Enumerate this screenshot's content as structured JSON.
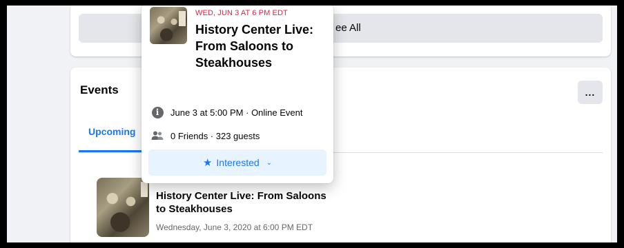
{
  "top_card": {
    "see_all_label": "ee All"
  },
  "events": {
    "title": "Events",
    "more_label": "...",
    "tabs": [
      {
        "label": "Upcoming"
      }
    ],
    "items": [
      {
        "title": "History Center Live: From Saloons to Steakhouses",
        "date": "Wednesday, June 3, 2020 at 6:00 PM EDT"
      }
    ]
  },
  "popup": {
    "date": "WED, JUN 3 AT 6 PM EDT",
    "title": "History Center Live: From Saloons to Steakhouses",
    "time_info": "June 3 at 5:00 PM · Online Event",
    "guests_info": "0 Friends · 323 guests",
    "interested_label": "Interested",
    "icons": {
      "info": "info-icon",
      "guests": "people-icon",
      "star": "star-icon",
      "chevron": "chevron-down-icon"
    }
  },
  "colors": {
    "accent": "#1877f2",
    "date_red": "#e41e3f",
    "background": "#f0f2f5"
  }
}
